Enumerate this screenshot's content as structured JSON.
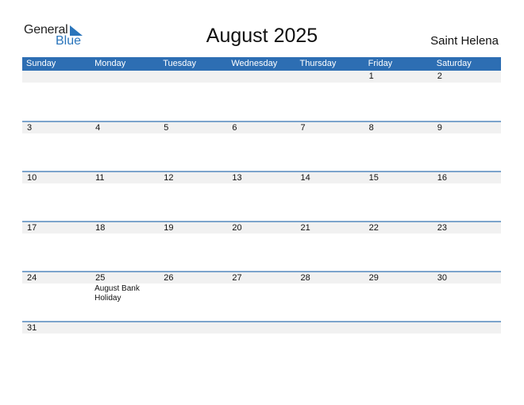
{
  "logo": {
    "word1": "General",
    "word2": "Blue"
  },
  "title": "August 2025",
  "country": "Saint Helena",
  "colors": {
    "header_bg": "#2d6eb3",
    "accent": "#2a75bb",
    "row_band": "#f1f1f1",
    "row_line": "#7ca4cc"
  },
  "weekdays": [
    "Sunday",
    "Monday",
    "Tuesday",
    "Wednesday",
    "Thursday",
    "Friday",
    "Saturday"
  ],
  "weeks": [
    {
      "days": [
        "",
        "",
        "",
        "",
        "",
        "1",
        "2"
      ],
      "events": [
        "",
        "",
        "",
        "",
        "",
        "",
        ""
      ]
    },
    {
      "days": [
        "3",
        "4",
        "5",
        "6",
        "7",
        "8",
        "9"
      ],
      "events": [
        "",
        "",
        "",
        "",
        "",
        "",
        ""
      ]
    },
    {
      "days": [
        "10",
        "11",
        "12",
        "13",
        "14",
        "15",
        "16"
      ],
      "events": [
        "",
        "",
        "",
        "",
        "",
        "",
        ""
      ]
    },
    {
      "days": [
        "17",
        "18",
        "19",
        "20",
        "21",
        "22",
        "23"
      ],
      "events": [
        "",
        "",
        "",
        "",
        "",
        "",
        ""
      ]
    },
    {
      "days": [
        "24",
        "25",
        "26",
        "27",
        "28",
        "29",
        "30"
      ],
      "events": [
        "",
        "August Bank Holiday",
        "",
        "",
        "",
        "",
        ""
      ]
    },
    {
      "days": [
        "31",
        "",
        "",
        "",
        "",
        "",
        ""
      ],
      "events": [
        "",
        "",
        "",
        "",
        "",
        "",
        ""
      ]
    }
  ]
}
